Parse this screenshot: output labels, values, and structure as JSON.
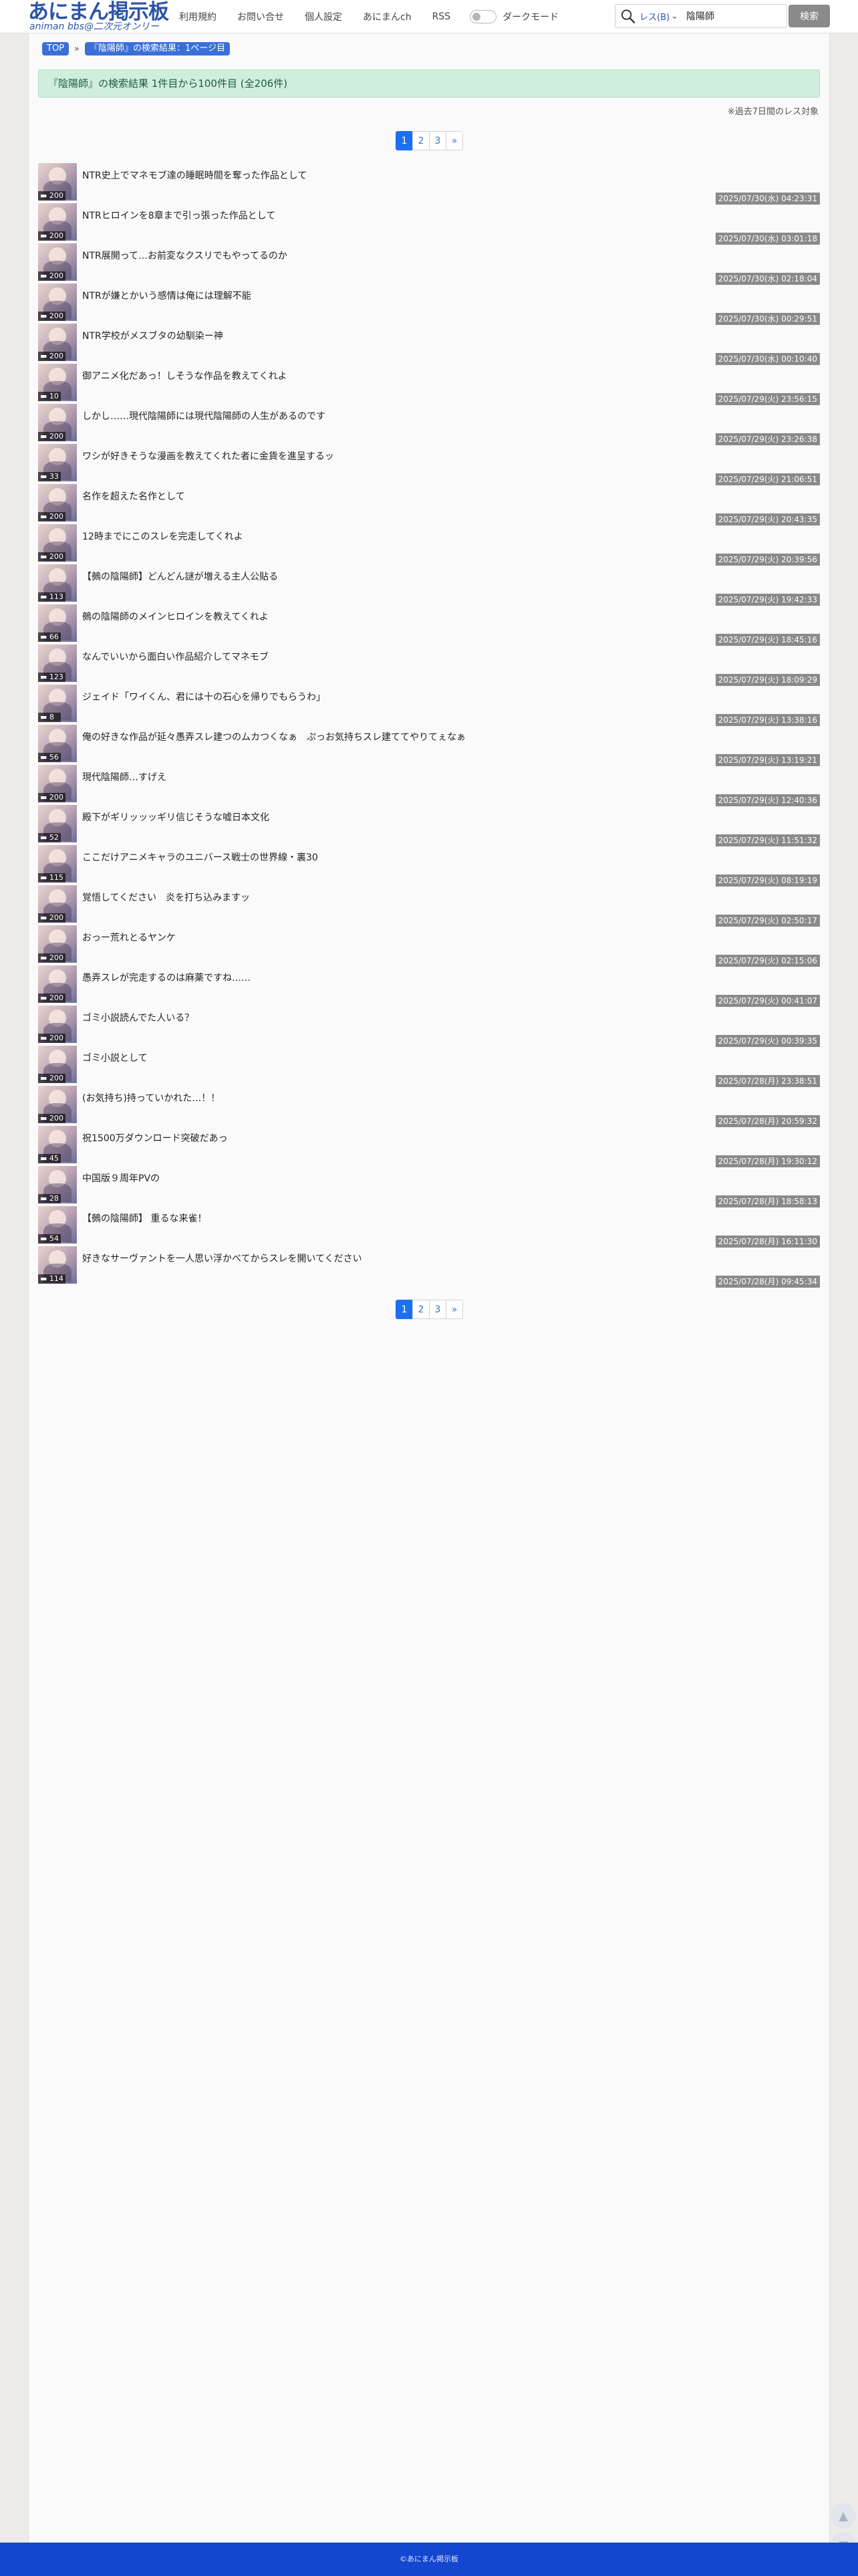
{
  "site": {
    "logo_main": "あにまん掲示板",
    "logo_sub": "animan bbs@二次元オンリー"
  },
  "nav": {
    "items": [
      "利用規約",
      "お問い合せ",
      "個人設定",
      "あにまんch",
      "RSS"
    ],
    "dark_mode_label": "ダークモード"
  },
  "search": {
    "type_label": "レス(B)",
    "type_caret": "⌄",
    "value": "陰陽師",
    "button_label": "検索"
  },
  "breadcrumb": [
    "TOP",
    "『陰陽師』の検索結果：1ページ目"
  ],
  "breadcrumb_sep": "»",
  "result_summary": "『陰陽師』の検索結果 1件目から100件目 (全206件)",
  "note": "※過去7日間のレス対象",
  "pagination": {
    "pages": [
      "1",
      "2",
      "3"
    ],
    "next": "»",
    "current": "1"
  },
  "threads": [
    {
      "title": "NTR史上でマネモブ達の睡眠時間を奪った作品として",
      "count": "200",
      "date": "2025/07/30(水) 04:23:31"
    },
    {
      "title": "NTRヒロインを8章まで引っ張った作品として",
      "count": "200",
      "date": "2025/07/30(水) 03:01:18"
    },
    {
      "title": "NTR展開って…お前変なクスリでもやってるのか",
      "count": "200",
      "date": "2025/07/30(水) 02:18:04"
    },
    {
      "title": "NTRが嫌とかいう感情は俺には理解不能",
      "count": "200",
      "date": "2025/07/30(水) 00:29:51"
    },
    {
      "title": "NTR学校がメスブタの幼馴染ー神",
      "count": "200",
      "date": "2025/07/30(水) 00:10:40"
    },
    {
      "title": "御アニメ化だあっ！しそうな作品を教えてくれよ",
      "count": "10",
      "date": "2025/07/29(火) 23:56:15"
    },
    {
      "title": "しかし……現代陰陽師には現代陰陽師の人生があるのです",
      "count": "200",
      "date": "2025/07/29(火) 23:26:38"
    },
    {
      "title": "ワシが好きそうな漫画を教えてくれた者に金貨を進呈するッ",
      "count": "33",
      "date": "2025/07/29(火) 21:06:51"
    },
    {
      "title": "名作を超えた名作として",
      "count": "200",
      "date": "2025/07/29(火) 20:43:35"
    },
    {
      "title": "12時までにこのスレを完走してくれよ",
      "count": "200",
      "date": "2025/07/29(火) 20:39:56"
    },
    {
      "title": "【鵺の陰陽師】どんどん謎が増える主人公貼る",
      "count": "113",
      "date": "2025/07/29(火) 19:42:33"
    },
    {
      "title": "鵺の陰陽師のメインヒロインを教えてくれよ",
      "count": "66",
      "date": "2025/07/29(火) 18:45:16"
    },
    {
      "title": "なんでいいから面白い作品紹介してマネモブ",
      "count": "123",
      "date": "2025/07/29(火) 18:09:29"
    },
    {
      "title": "ジェイド「ワイくん、君には十の石心を帰りでもらうわ」",
      "count": "8",
      "date": "2025/07/29(火) 13:38:16"
    },
    {
      "title": "俺の好きな作品が延々愚弄スレ建つのムカつくなぁ　ぷっお気持ちスレ建ててやりてぇなぁ",
      "count": "56",
      "date": "2025/07/29(火) 13:19:21"
    },
    {
      "title": "現代陰陽師…すげえ",
      "count": "200",
      "date": "2025/07/29(火) 12:40:36"
    },
    {
      "title": "殿下がギリッッッギリ信じそうな嘘日本文化",
      "count": "52",
      "date": "2025/07/29(火) 11:51:32"
    },
    {
      "title": "ここだけアニメキャラのユニバース戦士の世界線・裏30",
      "count": "115",
      "date": "2025/07/29(火) 08:19:19"
    },
    {
      "title": "覚悟してください　炎を打ち込みますッ",
      "count": "200",
      "date": "2025/07/29(火) 02:50:17"
    },
    {
      "title": "おっー荒れとるヤンケ",
      "count": "200",
      "date": "2025/07/29(火) 02:15:06"
    },
    {
      "title": "愚弄スレが完走するのは麻薬ですね……",
      "count": "200",
      "date": "2025/07/29(火) 00:41:07"
    },
    {
      "title": "ゴミ小説読んでた人いる？",
      "count": "200",
      "date": "2025/07/29(火) 00:39:35"
    },
    {
      "title": "ゴミ小説として",
      "count": "200",
      "date": "2025/07/28(月) 23:38:51"
    },
    {
      "title": "(お気持ち)持っていかれた…！！",
      "count": "200",
      "date": "2025/07/28(月) 20:59:32"
    },
    {
      "title": "祝1500万ダウンロード突破だあっ",
      "count": "45",
      "date": "2025/07/28(月) 19:30:12"
    },
    {
      "title": "中国版９周年PVの",
      "count": "28",
      "date": "2025/07/28(月) 18:58:13"
    },
    {
      "title": "【鵺の陰陽師】 重るな来雀！",
      "count": "54",
      "date": "2025/07/28(月) 16:11:30"
    },
    {
      "title": "好きなサーヴァントを一人思い浮かべてからスレを開いてください",
      "count": "114",
      "date": "2025/07/28(月) 09:45:34"
    }
  ],
  "footer": {
    "copyright": "©あにまん掲示板"
  },
  "side_buttons": {
    "up_icon": "▲",
    "down_icon": "▼"
  },
  "colors": {
    "accent": "#1d6ff2",
    "footer": "#1446cf",
    "banner": "#cfeedd",
    "date_badge": "#8a8a8a"
  }
}
